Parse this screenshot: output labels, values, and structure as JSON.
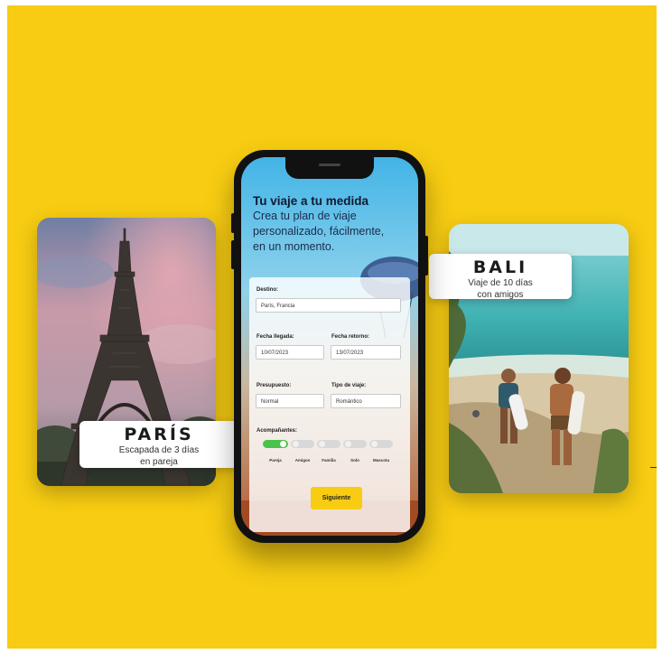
{
  "paris": {
    "title": "PARÍS",
    "subtitle_line1": "Escapada de 3 días",
    "subtitle_line2": "en pareja"
  },
  "bali": {
    "title": "BALI",
    "subtitle_line1": "Viaje de 10 días",
    "subtitle_line2": "con amigos"
  },
  "phone": {
    "headline": "Tu viaje a tu medida",
    "subhead_line1": "Crea tu plan de viaje",
    "subhead_line2": "personalizado, fácilmente,",
    "subhead_line3": "en un momento.",
    "form": {
      "destino_label": "Destino:",
      "destino_value": "París, Francia",
      "llegada_label": "Fecha llegada:",
      "llegada_value": "10/07/2023",
      "retorno_label": "Fecha retorno:",
      "retorno_value": "13/07/2023",
      "presupuesto_label": "Presupuesto:",
      "presupuesto_value": "Normal",
      "tipo_label": "Tipo de viaje:",
      "tipo_value": "Romántico",
      "acompanantes_label": "Acompañantes:",
      "companions": [
        {
          "label": "Pareja",
          "selected": true
        },
        {
          "label": "Amigos",
          "selected": false
        },
        {
          "label": "Familia",
          "selected": false
        },
        {
          "label": "Solo",
          "selected": false
        },
        {
          "label": "Mascota",
          "selected": false
        }
      ],
      "next_label": "Siguiente"
    }
  },
  "colors": {
    "background": "#f7cc12",
    "accent": "#f7cc12",
    "toggle_on": "#49c44a"
  }
}
